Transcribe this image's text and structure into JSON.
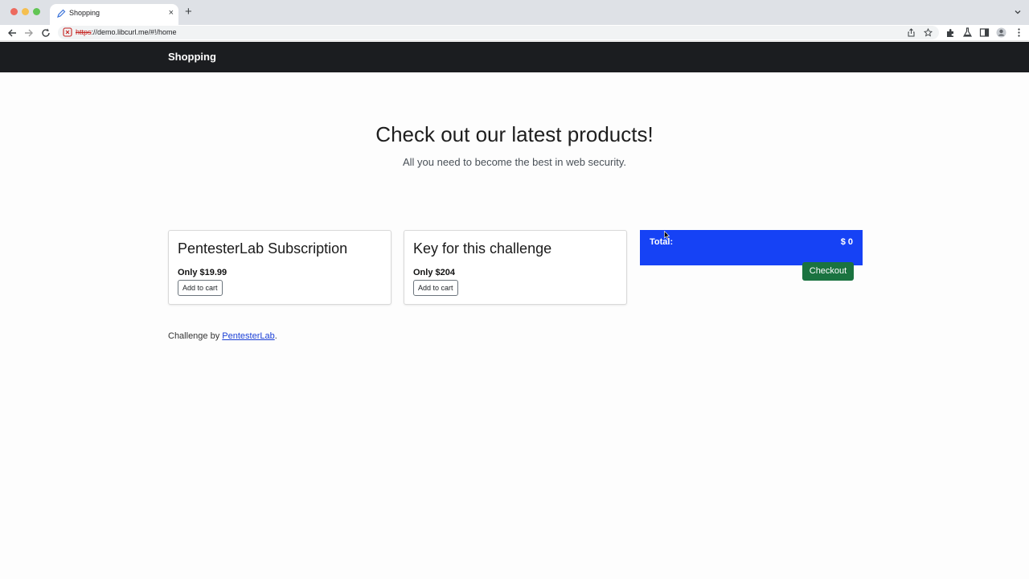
{
  "browser": {
    "tab": {
      "title": "Shopping",
      "close_glyph": "×"
    },
    "new_tab_glyph": "+",
    "url_scheme": "https",
    "url_rest": "://demo.libcurl.me/#!/home",
    "icons": [
      "back-arrow-icon",
      "forward-arrow-icon",
      "reload-icon",
      "not-secure-icon",
      "share-icon",
      "bookmark-star-icon",
      "extensions-icon",
      "labs-icon",
      "side-panel-icon",
      "profile-icon",
      "menu-icon"
    ]
  },
  "navbar": {
    "brand": "Shopping"
  },
  "hero": {
    "title": "Check out our latest products!",
    "subtitle": "All you need to become the best in web security."
  },
  "products": [
    {
      "name": "PentesterLab Subscription",
      "price": "Only $19.99",
      "button": "Add to cart"
    },
    {
      "name": "Key for this challenge",
      "price": "Only $204",
      "button": "Add to cart"
    }
  ],
  "cart": {
    "total_label": "Total:",
    "total_value": "$ 0",
    "checkout": "Checkout"
  },
  "footer": {
    "prefix": "Challenge by ",
    "link": "PentesterLab",
    "suffix": "."
  },
  "colors": {
    "navbar": "#1b1d20",
    "cart": "#1642f5",
    "checkout": "#1a7340",
    "link": "#1a3fd6"
  }
}
